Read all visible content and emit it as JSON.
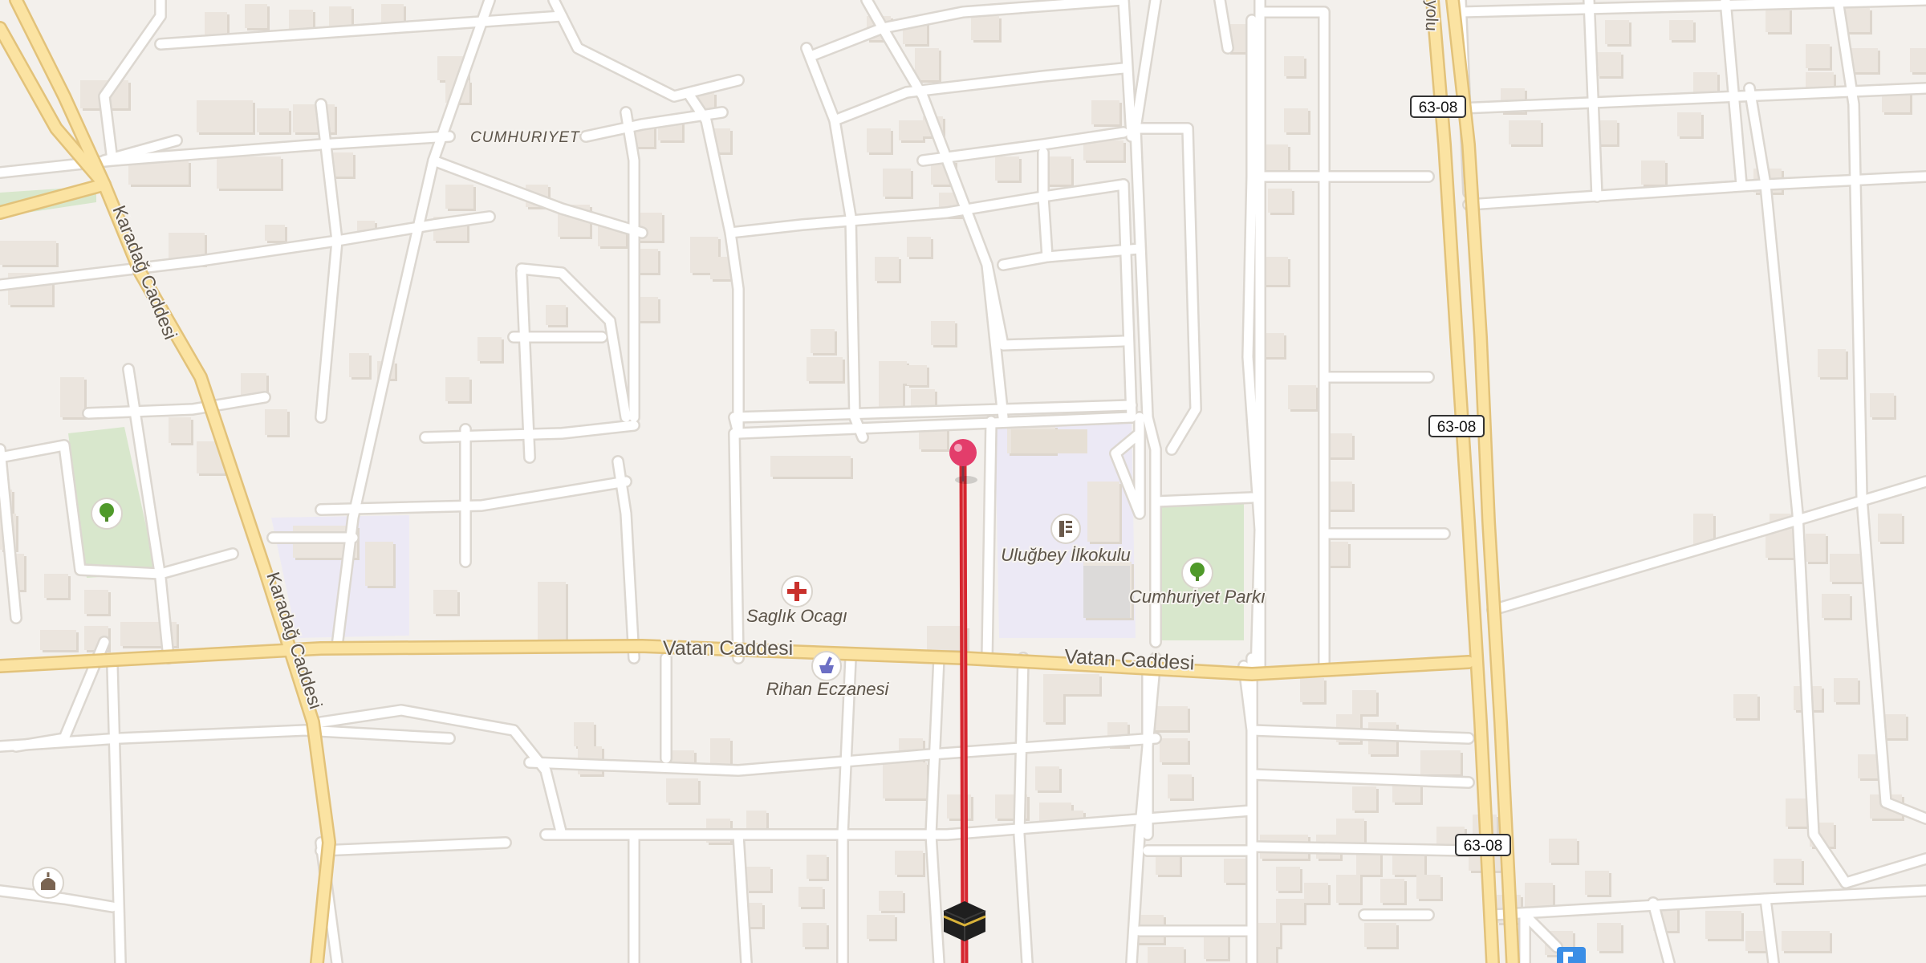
{
  "map": {
    "colors": {
      "background": "#f3f0ec",
      "street": "#ffffff",
      "street_casing": "#dcd7d0",
      "major_road_fill": "#fbe3a2",
      "major_road_casing": "#e2c27a",
      "building": "#ebe5de",
      "building_shadow": "#ddd6cd",
      "park": "#d8e7cc",
      "school_area": "#ece9f5",
      "route_line": "#d6262f",
      "pin": "#e33d6b"
    },
    "street_labels": {
      "cumhuriyet": "CUMHURIYET",
      "karadag_1": "Karadağ Caddesi",
      "karadag_2": "Karadağ Caddesi",
      "vatan_1": "Vatan Caddesi",
      "vatan_2": "Vatan Caddesi",
      "yolu_partial": "yolu"
    },
    "road_shields": [
      "63-08",
      "63-08",
      "63-08"
    ],
    "pois": {
      "health": {
        "name": "Saglık Ocagı",
        "icon": "medical-cross-icon"
      },
      "pharmacy": {
        "name": "Rihan Eczanesi",
        "icon": "pharmacy-mortar-icon"
      },
      "school": {
        "name": "Uluğbey İlkokulu",
        "icon": "school-icon"
      },
      "park": {
        "name": "Cumhuriyet Parkı",
        "icon": "tree-icon"
      },
      "park_west": {
        "icon": "tree-icon"
      },
      "mosque": {
        "icon": "mosque-icon"
      },
      "kaaba": {
        "icon": "kaaba-icon"
      },
      "parking": {
        "icon": "parking-icon"
      },
      "pin": {
        "icon": "location-pin-icon"
      }
    }
  }
}
